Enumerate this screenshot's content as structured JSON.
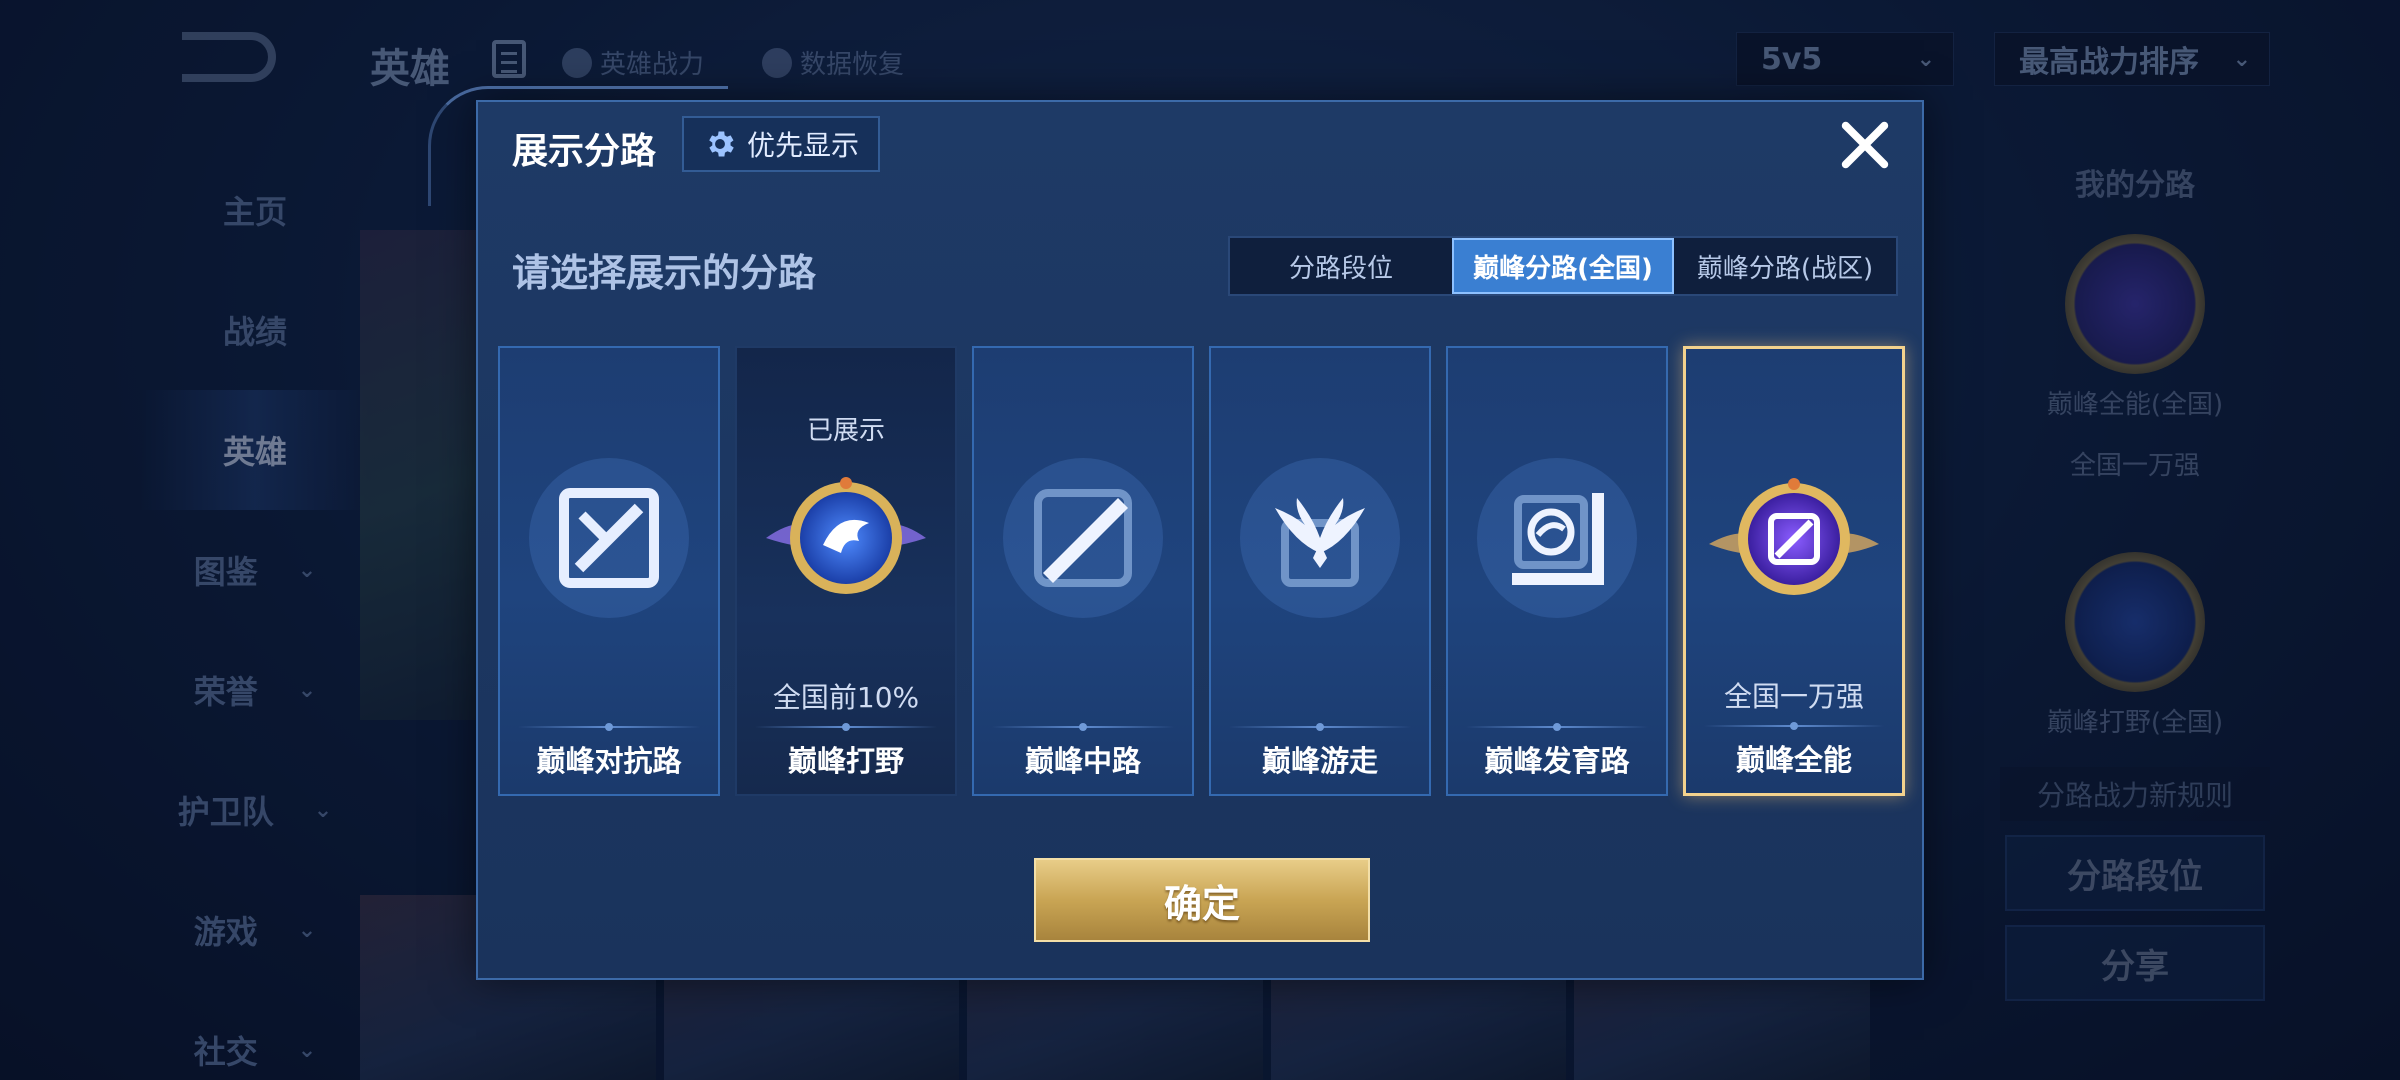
{
  "background": {
    "top_title": "英雄",
    "top_links": [
      "英雄战力",
      "数据恢复"
    ],
    "mode_select": "5v5",
    "sort_select": "最高战力排序",
    "side_nav": [
      {
        "label": "主页",
        "has_arrow": false
      },
      {
        "label": "战绩",
        "has_arrow": false
      },
      {
        "label": "英雄",
        "has_arrow": false,
        "active": true
      },
      {
        "label": "图鉴",
        "has_arrow": true
      },
      {
        "label": "荣誉",
        "has_arrow": true
      },
      {
        "label": "护卫队",
        "has_arrow": true
      },
      {
        "label": "游戏",
        "has_arrow": true
      },
      {
        "label": "社交",
        "has_arrow": true
      }
    ],
    "right_panel": {
      "title": "我的分路",
      "emblem1_label": "巅峰全能(全国)",
      "emblem1_rank": "全国一万强",
      "emblem2_label": "巅峰打野(全国)",
      "rules_link": "分路战力新规则",
      "btn_rank": "分路段位",
      "btn_share": "分享"
    }
  },
  "modal": {
    "title": "展示分路",
    "priority_button": "优先显示",
    "subtitle": "请选择展示的分路",
    "tabs": [
      {
        "label": "分路段位",
        "active": false
      },
      {
        "label": "巅峰分路(全国)",
        "active": true
      },
      {
        "label": "巅峰分路(战区)",
        "active": false
      }
    ],
    "cards": [
      {
        "label": "巅峰对抗路",
        "icon": "clash-lane-icon",
        "status": "",
        "rank": "",
        "style": "light",
        "selected": false
      },
      {
        "label": "巅峰打野",
        "icon": "jungle-dragon-emblem-icon",
        "status": "已展示",
        "rank": "全国前10%",
        "style": "dark",
        "selected": false
      },
      {
        "label": "巅峰中路",
        "icon": "mid-lane-icon",
        "status": "",
        "rank": "",
        "style": "light",
        "selected": false
      },
      {
        "label": "巅峰游走",
        "icon": "roam-wings-icon",
        "status": "",
        "rank": "",
        "style": "light",
        "selected": false
      },
      {
        "label": "巅峰发育路",
        "icon": "farm-lane-icon",
        "status": "",
        "rank": "",
        "style": "light",
        "selected": false
      },
      {
        "label": "巅峰全能",
        "icon": "all-round-emblem-icon",
        "status": "",
        "rank": "全国一万强",
        "style": "light",
        "selected": true
      }
    ],
    "confirm_button": "确定"
  },
  "colors": {
    "accent_blue": "#3a7fd2",
    "gold": "#c9a554",
    "selected_border": "#f3d28d"
  }
}
